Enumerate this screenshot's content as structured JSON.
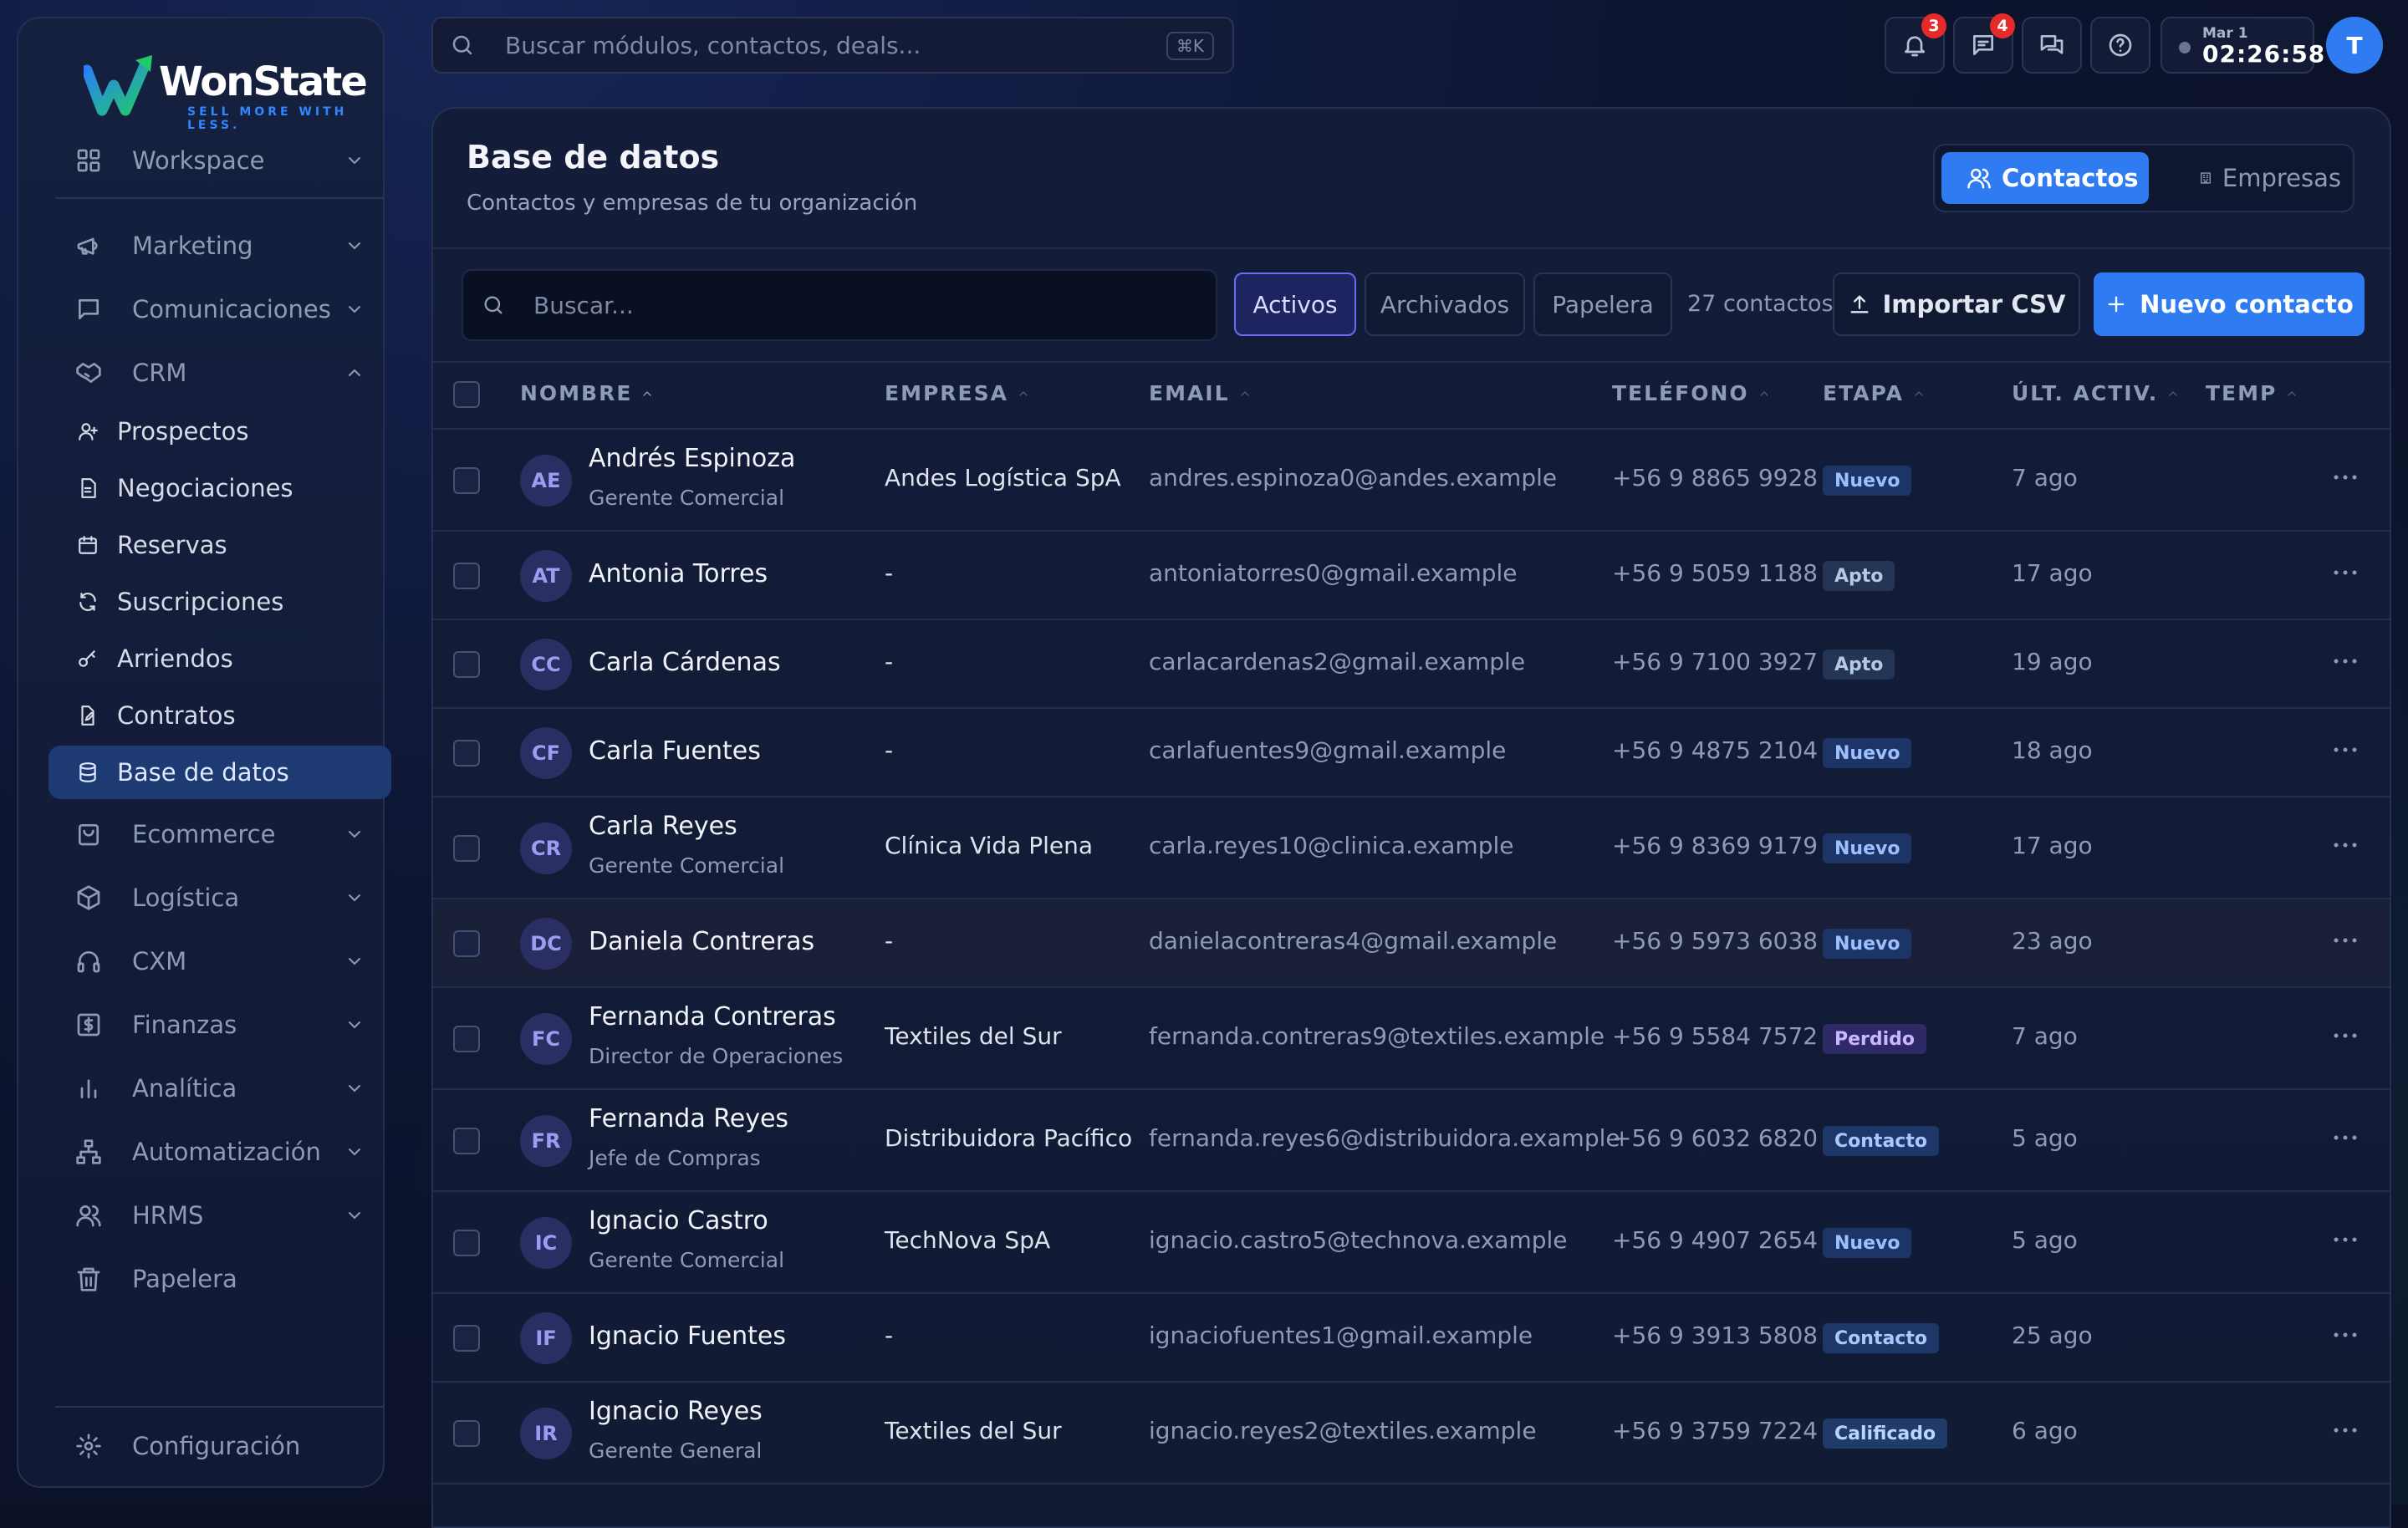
{
  "brand": {
    "name": "WonState",
    "tagline": "SELL MORE WITH LESS."
  },
  "sidebar": {
    "items": [
      {
        "label": "Workspace",
        "icon": "grid-icon"
      },
      {
        "label": "Marketing",
        "icon": "megaphone-icon"
      },
      {
        "label": "Comunicaciones",
        "icon": "message-icon"
      },
      {
        "label": "CRM",
        "icon": "handshake-icon"
      },
      {
        "label": "Ecommerce",
        "icon": "shopping-bag-icon"
      },
      {
        "label": "Logística",
        "icon": "box-icon"
      },
      {
        "label": "CXM",
        "icon": "headphones-icon"
      },
      {
        "label": "Finanzas",
        "icon": "dollar-icon"
      },
      {
        "label": "Analítica",
        "icon": "bar-chart-icon"
      },
      {
        "label": "Automatización",
        "icon": "network-icon"
      },
      {
        "label": "HRMS",
        "icon": "users-icon"
      },
      {
        "label": "Papelera",
        "icon": "trash-icon"
      }
    ],
    "crm_sub": [
      {
        "label": "Prospectos",
        "icon": "user-icon"
      },
      {
        "label": "Negociaciones",
        "icon": "file-icon"
      },
      {
        "label": "Reservas",
        "icon": "calendar-icon"
      },
      {
        "label": "Suscripciones",
        "icon": "refresh-icon"
      },
      {
        "label": "Arriendos",
        "icon": "key-icon"
      },
      {
        "label": "Contratos",
        "icon": "file-edit-icon"
      },
      {
        "label": "Base de datos",
        "icon": "database-icon"
      }
    ],
    "settings": "Configuración"
  },
  "topbar": {
    "search_placeholder": "Buscar módulos, contactos, deals...",
    "shortcut": "⌘K",
    "notifications_count": "3",
    "messages_count": "4",
    "clock_date": "Mar 1",
    "clock_time": "02:26:58",
    "user_initial": "T"
  },
  "page": {
    "title": "Base de datos",
    "subtitle": "Contactos y empresas de tu organización",
    "tab_contacts": "Contactos",
    "tab_companies": "Empresas",
    "search_placeholder": "Buscar...",
    "filter_active": "Activos",
    "filter_archived": "Archivados",
    "filter_trash": "Papelera",
    "count": "27 contactos",
    "import_label": "Importar CSV",
    "new_label": "Nuevo contacto"
  },
  "table": {
    "headers": {
      "name": "NOMBRE",
      "company": "EMPRESA",
      "email": "EMAIL",
      "phone": "TELÉFONO",
      "stage": "ETAPA",
      "activity": "ÚLT. ACTIV.",
      "temp": "TEMP"
    },
    "rows": [
      {
        "initials": "AE",
        "name": "Andrés Espinoza",
        "role": "Gerente Comercial",
        "company": "Andes Logística SpA",
        "email": "andres.espinoza0@andes.example",
        "phone": "+56 9 8865 9928",
        "stage": "Nuevo",
        "activity": "7 ago"
      },
      {
        "initials": "AT",
        "name": "Antonia Torres",
        "role": "",
        "company": "-",
        "email": "antoniatorres0@gmail.example",
        "phone": "+56 9 5059 1188",
        "stage": "Apto",
        "activity": "17 ago"
      },
      {
        "initials": "CC",
        "name": "Carla Cárdenas",
        "role": "",
        "company": "-",
        "email": "carlacardenas2@gmail.example",
        "phone": "+56 9 7100 3927",
        "stage": "Apto",
        "activity": "19 ago"
      },
      {
        "initials": "CF",
        "name": "Carla Fuentes",
        "role": "",
        "company": "-",
        "email": "carlafuentes9@gmail.example",
        "phone": "+56 9 4875 2104",
        "stage": "Nuevo",
        "activity": "18 ago"
      },
      {
        "initials": "CR",
        "name": "Carla Reyes",
        "role": "Gerente Comercial",
        "company": "Clínica Vida Plena",
        "email": "carla.reyes10@clinica.example",
        "phone": "+56 9 8369 9179",
        "stage": "Nuevo",
        "activity": "17 ago"
      },
      {
        "initials": "DC",
        "name": "Daniela Contreras",
        "role": "",
        "company": "-",
        "email": "danielacontreras4@gmail.example",
        "phone": "+56 9 5973 6038",
        "stage": "Nuevo",
        "activity": "23 ago"
      },
      {
        "initials": "FC",
        "name": "Fernanda Contreras",
        "role": "Director de Operaciones",
        "company": "Textiles del Sur",
        "email": "fernanda.contreras9@textiles.example",
        "phone": "+56 9 5584 7572",
        "stage": "Perdido",
        "activity": "7 ago"
      },
      {
        "initials": "FR",
        "name": "Fernanda Reyes",
        "role": "Jefe de Compras",
        "company": "Distribuidora Pacífico",
        "email": "fernanda.reyes6@distribuidora.example",
        "phone": "+56 9 6032 6820",
        "stage": "Contacto",
        "activity": "5 ago"
      },
      {
        "initials": "IC",
        "name": "Ignacio Castro",
        "role": "Gerente Comercial",
        "company": "TechNova SpA",
        "email": "ignacio.castro5@technova.example",
        "phone": "+56 9 4907 2654",
        "stage": "Nuevo",
        "activity": "5 ago"
      },
      {
        "initials": "IF",
        "name": "Ignacio Fuentes",
        "role": "",
        "company": "-",
        "email": "ignaciofuentes1@gmail.example",
        "phone": "+56 9 3913 5808",
        "stage": "Contacto",
        "activity": "25 ago"
      },
      {
        "initials": "IR",
        "name": "Ignacio Reyes",
        "role": "Gerente General",
        "company": "Textiles del Sur",
        "email": "ignacio.reyes2@textiles.example",
        "phone": "+56 9 3759 7224",
        "stage": "Calificado",
        "activity": "6 ago"
      }
    ]
  },
  "colors": {
    "accent": "#2f7bf2",
    "stage_nuevo": "#9cc0ff",
    "stage_apto": "#b4c8e8",
    "stage_perdido": "#c9b8ff",
    "stage_contacto": "#a9c8ff",
    "stage_calificado": "#b8d4ff"
  }
}
